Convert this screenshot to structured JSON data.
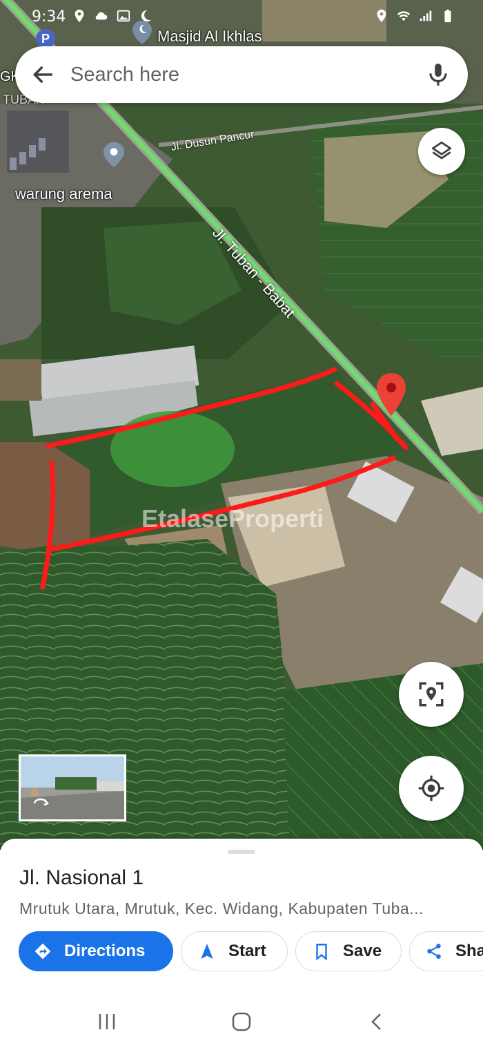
{
  "status_bar": {
    "time": "9:34",
    "left_icons": [
      "location-icon",
      "cloud-icon",
      "image-icon",
      "moon-icon"
    ],
    "right_icons": [
      "location-icon",
      "wifi-icon",
      "signal-icon",
      "battery-icon"
    ]
  },
  "search": {
    "placeholder": "Search here"
  },
  "map": {
    "labels": {
      "masjid": "Masjid Al Ikhlas",
      "warung": "warung arema",
      "dusun": "Jl. Dusun Pancur",
      "tuban_babat": "Jl. Tuban - Babat",
      "partial_left_1": "GK",
      "partial_left_2": "TUBAN",
      "parking": "P"
    },
    "watermark": "EtalaseProperti"
  },
  "place": {
    "title": "Jl. Nasional 1",
    "address": "Mrutuk Utara, Mrutuk, Kec. Widang, Kabupaten Tuba..."
  },
  "actions": {
    "directions": "Directions",
    "start": "Start",
    "save": "Save",
    "share": "Sha"
  },
  "colors": {
    "accent": "#1a73e8",
    "marker": "#ea4335",
    "road": "#6fdc6f",
    "outline": "#ff0000"
  }
}
